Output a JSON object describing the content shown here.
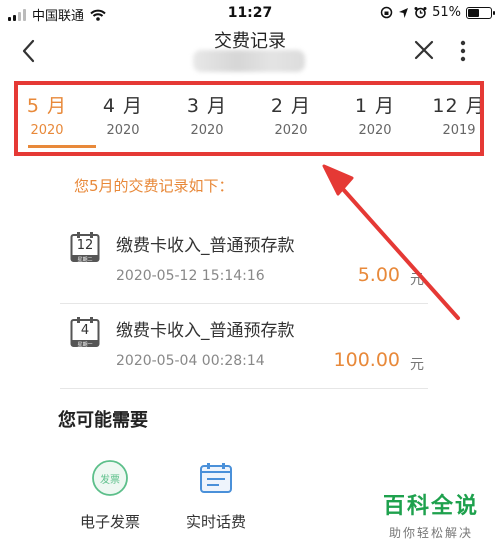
{
  "status_bar": {
    "carrier": "中国联通",
    "time": "11:27",
    "battery": "51%",
    "battery_level": 0.51,
    "icons": [
      "signal-icon",
      "wifi-icon",
      "orientation-lock-icon",
      "location-icon",
      "alarm-icon",
      "battery-icon"
    ]
  },
  "navbar": {
    "title": "交费记录",
    "icons": [
      "back-icon",
      "close-icon",
      "more-icon"
    ]
  },
  "tabs": [
    {
      "month": "5 月",
      "year": "2020",
      "active": true
    },
    {
      "month": "4 月",
      "year": "2020",
      "active": false
    },
    {
      "month": "3 月",
      "year": "2020",
      "active": false
    },
    {
      "month": "2 月",
      "year": "2020",
      "active": false
    },
    {
      "month": "1 月",
      "year": "2020",
      "active": false
    },
    {
      "month": "12 月",
      "year": "2019",
      "active": false
    }
  ],
  "records": {
    "heading": "您5月的交费记录如下：",
    "items": [
      {
        "day": "12",
        "weekday": "星期二",
        "title": "缴费卡收入_普通预存款",
        "datetime": "2020-05-12 15:14:16",
        "amount": "5.00",
        "unit": "元"
      },
      {
        "day": "4",
        "weekday": "星期一",
        "title": "缴费卡收入_普通预存款",
        "datetime": "2020-05-04 00:28:14",
        "amount": "100.00",
        "unit": "元"
      }
    ]
  },
  "suggestions": {
    "title": "您可能需要",
    "items": [
      {
        "label": "电子发票",
        "icon": "invoice-icon",
        "badge": "发票"
      },
      {
        "label": "实时话费",
        "icon": "bill-icon"
      }
    ]
  },
  "watermark": {
    "title": "百科全说",
    "subtitle": "助你轻松解决"
  },
  "colors": {
    "accent": "#e8893a",
    "annotation": "#e53935",
    "invoice_green": "#5cbf8a",
    "bill_blue": "#4a90d9"
  }
}
